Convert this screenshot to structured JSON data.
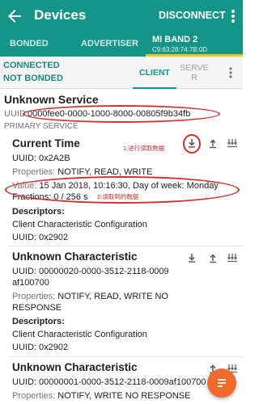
{
  "appbar": {
    "title": "Devices",
    "action": "DISCONNECT"
  },
  "tabs": [
    {
      "label": "BONDED"
    },
    {
      "label": "ADVERTISER"
    },
    {
      "label": "MI BAND 2",
      "sub": "C9:63:28:74:7B:0D",
      "active": true
    }
  ],
  "status": {
    "line1": "CONNECTED",
    "line2": "NOT BONDED"
  },
  "subtabs": {
    "client": "CLIENT",
    "server_line1": "SERVE",
    "server_line2": "R"
  },
  "service": {
    "name": "Unknown Service",
    "uuid_label": "UUID:",
    "uuid": "0000fee0-0000-1000-8000-00805f9b34fb",
    "type": "PRIMARY SERVICE"
  },
  "characteristics": [
    {
      "name": "Current Time",
      "uuid_line": "UUID: 0x2A2B",
      "props_label": "Properties:",
      "props": "NOTIFY, READ, WRITE",
      "value_label": "Value:",
      "value": "15 Jan 2018, 10:16:30, Day of week: Monday",
      "fractions": "Fractions: 0 / 256 s",
      "desc_header": "Descriptors:",
      "desc_name": "Client Characteristic Configuration",
      "desc_uuid": "UUID: 0x2902"
    },
    {
      "name": "Unknown Characteristic",
      "uuid_line": "UUID: 00000020-0000-3512-2118-0009",
      "uuid_line2": "af100700",
      "props_label": "Properties:",
      "props": "NOTIFY, READ, WRITE NO",
      "props2": "RESPONSE",
      "desc_header": "Descriptors:",
      "desc_name": "Client Characteristic Configuration",
      "desc_uuid": "UUID: 0x2902"
    },
    {
      "name": "Unknown Characteristic",
      "uuid_line": "UUID: 00000001-0000-3512-2118-0009af100700",
      "props_label": "Properties:",
      "props": "NOTIFY, WRITE NO RESPONSE"
    }
  ],
  "annotations": {
    "step1": "1.进行读取数据",
    "step2": "2.读取到的数据"
  },
  "colors": {
    "primary": "#159488",
    "indicator": "#f5c518",
    "annotation": "#d32f2f",
    "fab": "#ef6c2c"
  },
  "icons": [
    "back-arrow-icon",
    "more-vert-icon",
    "menu-icon",
    "read-download-icon",
    "write-upload-icon",
    "notify-multi-download-icon",
    "list-fab-icon"
  ]
}
